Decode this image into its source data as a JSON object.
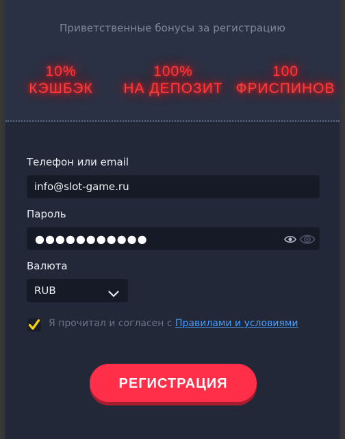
{
  "header": {
    "welcome_text": "Приветственные бонусы за регистрацию",
    "bonuses": [
      {
        "line1": "10%",
        "line2": "КЭШБЭК"
      },
      {
        "line1": "100%",
        "line2": "НА ДЕПОЗИТ"
      },
      {
        "line1": "100",
        "line2": "ФРИСПИНОВ"
      }
    ],
    "glow_color": "#ff3b3b"
  },
  "form": {
    "login_label": "Телефон или email",
    "login_value": "info@slot-game.ru",
    "password_label": "Пароль",
    "password_masked": "●●●●●●●●●●●",
    "password_icons": [
      "eye-icon",
      "eye-icon"
    ],
    "currency_label": "Валюта",
    "currency_value": "RUB",
    "currency_icon": "chevron-down-icon",
    "agree_checked": true,
    "agree_text": "Я прочитал и согласен с",
    "agree_link": "Правилами и условиями",
    "submit_label": "РЕГИСТРАЦИЯ"
  },
  "colors": {
    "accent": "#ff2e49",
    "checkbox": "#f5d000",
    "link": "#4a9cff"
  }
}
